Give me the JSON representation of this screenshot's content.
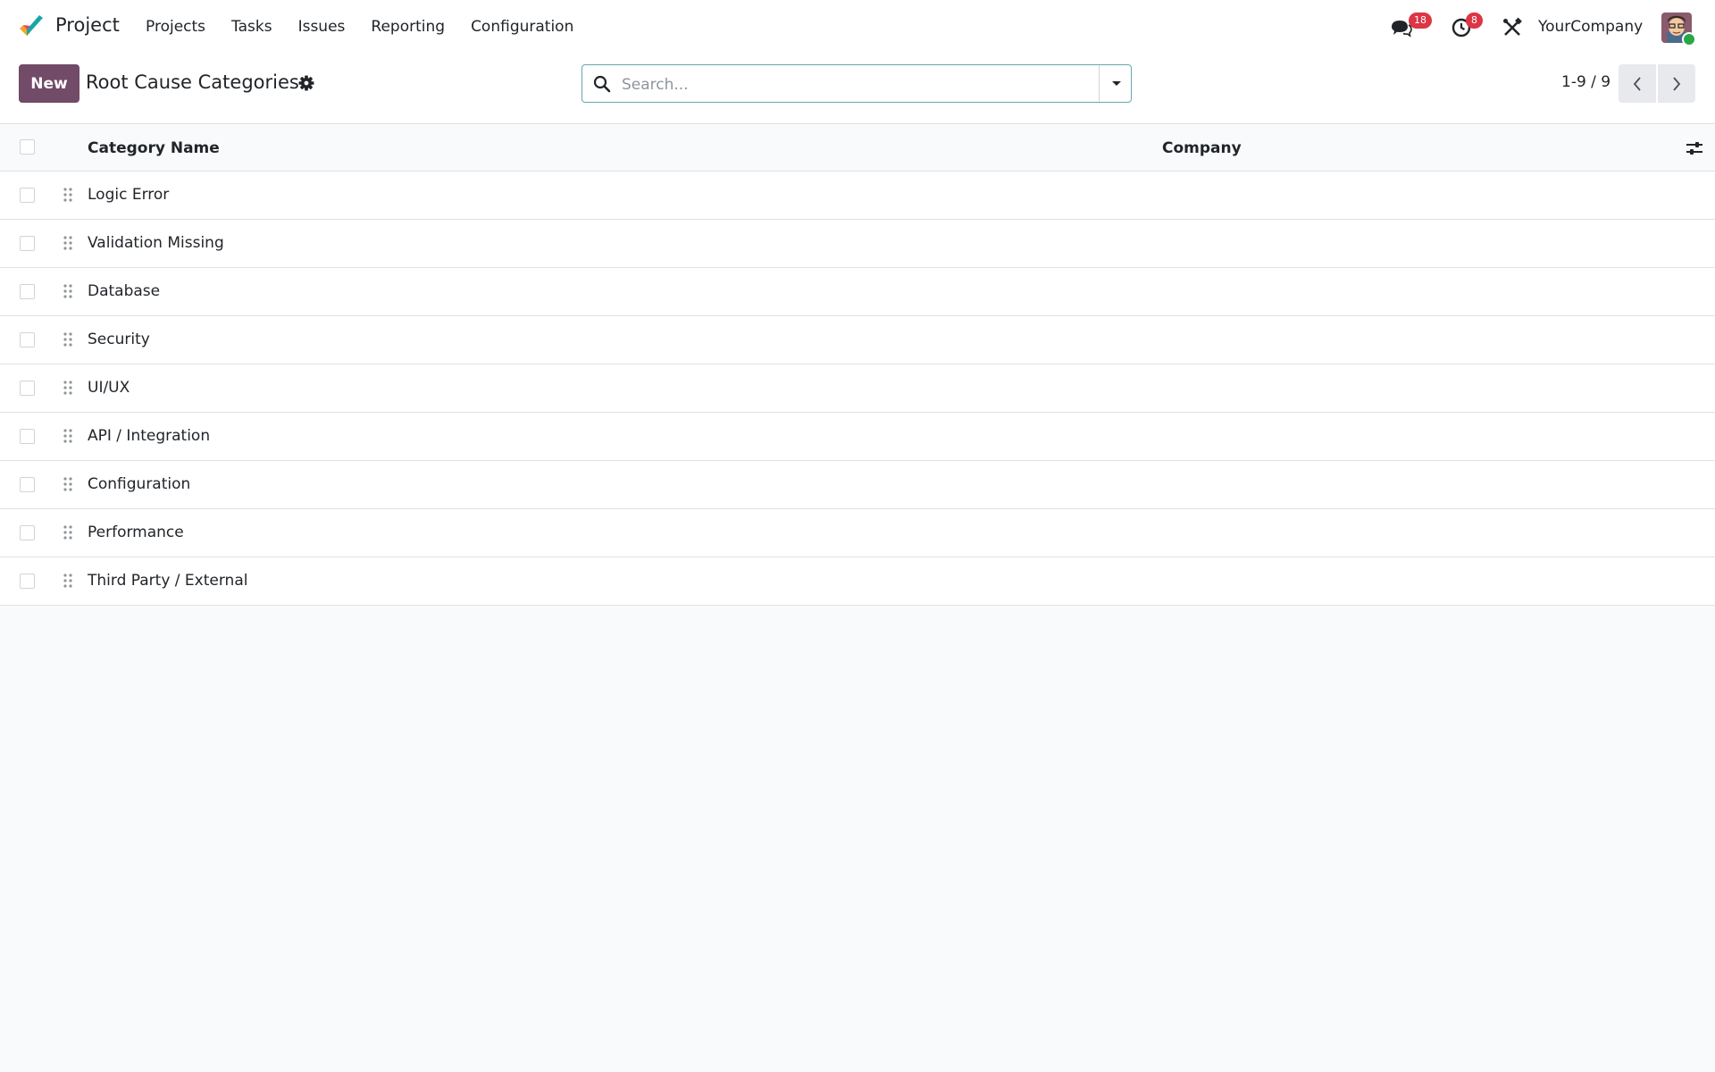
{
  "navbar": {
    "app_name": "Project",
    "menu": [
      {
        "label": "Projects"
      },
      {
        "label": "Tasks"
      },
      {
        "label": "Issues"
      },
      {
        "label": "Reporting"
      },
      {
        "label": "Configuration"
      }
    ],
    "messages_count": "18",
    "activities_count": "8",
    "company": "YourCompany"
  },
  "control": {
    "new_label": "New",
    "title": "Root Cause Categories",
    "search_placeholder": "Search...",
    "pager_value": "1-9 / 9"
  },
  "table": {
    "columns": {
      "name": "Category Name",
      "company": "Company"
    },
    "rows": [
      {
        "name": "Logic Error",
        "company": ""
      },
      {
        "name": "Validation Missing",
        "company": ""
      },
      {
        "name": "Database",
        "company": ""
      },
      {
        "name": "Security",
        "company": ""
      },
      {
        "name": "UI/UX",
        "company": ""
      },
      {
        "name": "API / Integration",
        "company": ""
      },
      {
        "name": "Configuration",
        "company": ""
      },
      {
        "name": "Performance",
        "company": ""
      },
      {
        "name": "Third Party / External",
        "company": ""
      }
    ]
  },
  "colors": {
    "brand": "#714b67",
    "badge": "#dc3545",
    "online": "#28a745",
    "search_border": "#66a8b0"
  },
  "icons": {
    "logo": "project-logo-icon",
    "messages": "chat-icon",
    "activities": "clock-icon",
    "debug": "tools-icon",
    "settings": "gear-icon",
    "search": "search-icon",
    "toggle": "caret-down-icon",
    "optional_columns": "sliders-icon",
    "handle": "drag-handle-icon"
  }
}
